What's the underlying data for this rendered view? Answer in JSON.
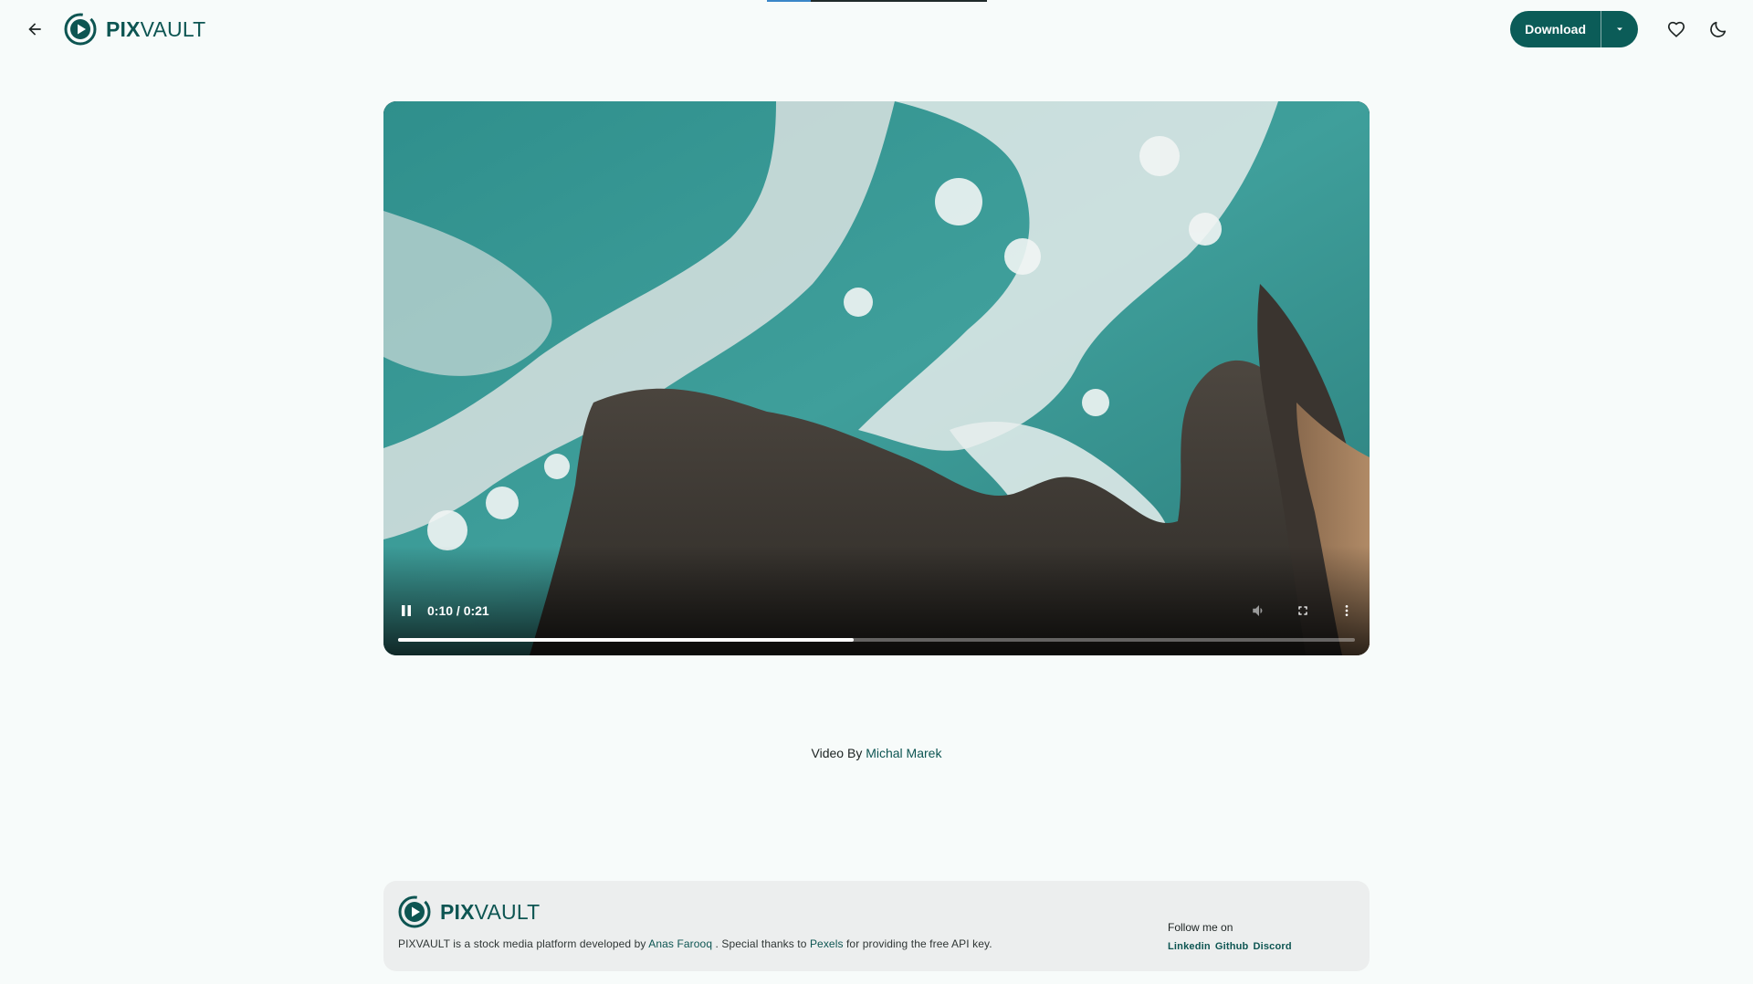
{
  "header": {
    "logo_bold": "PIX",
    "logo_light": "VAULT",
    "download_label": "Download",
    "icons": [
      "arrow-back-icon",
      "logo-icon",
      "caret-down-icon",
      "heart-icon",
      "moon-icon"
    ]
  },
  "top_loading": {
    "progress": 0.2
  },
  "video": {
    "time": "0:10 / 0:21",
    "played_fraction": 0.4762,
    "controls": [
      "pause-icon",
      "volume-icon",
      "fullscreen-icon",
      "more-vert-icon"
    ]
  },
  "credit": {
    "prefix": "Video By",
    "author": "Michal Marek"
  },
  "footer": {
    "logo_bold": "PIX",
    "logo_light": "VAULT",
    "desc_part1": "PIXVAULT is a stock media platform developed by",
    "desc_author": "Anas Farooq",
    "desc_part2": ". Special thanks to",
    "desc_pexels": "Pexels",
    "desc_part3": "for providing the free API key.",
    "follow_title": "Follow me on",
    "links": [
      "Linkedin",
      "Github",
      "Discord"
    ]
  },
  "colors": {
    "brand": "#0b5c58",
    "background": "#f7fbfa",
    "footer_bg": "#eceeee",
    "link": "#0d5552"
  }
}
